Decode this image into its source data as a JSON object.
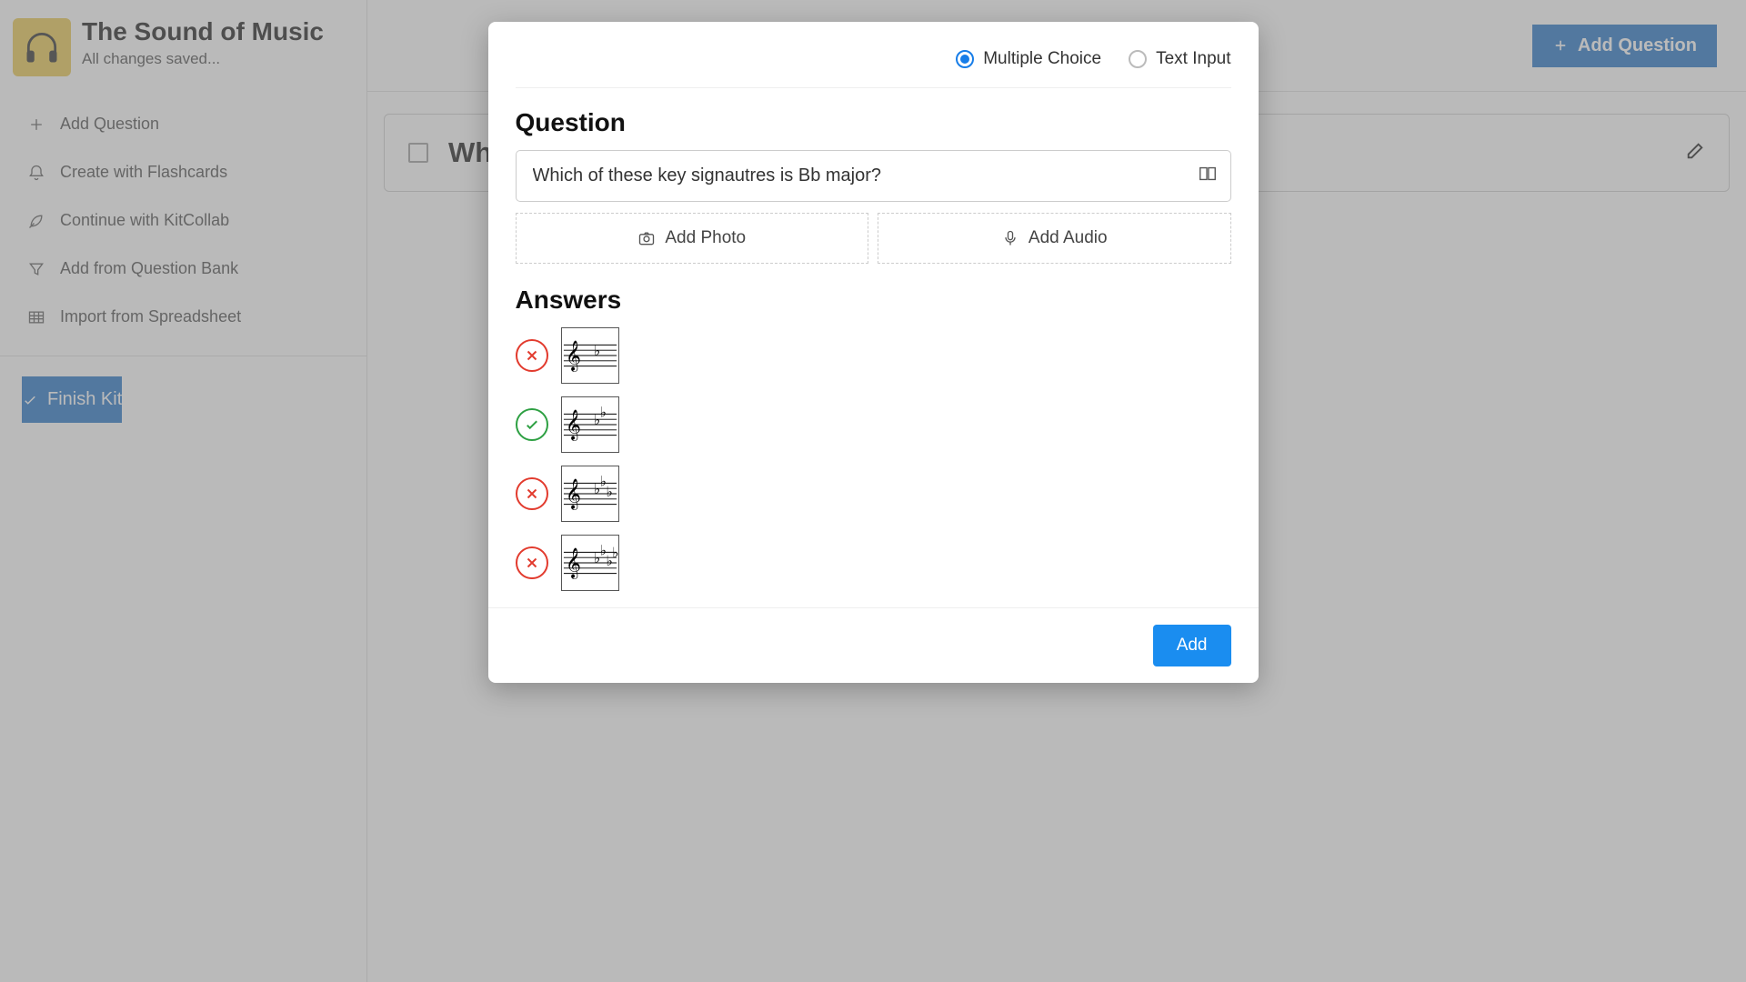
{
  "kit": {
    "title": "The Sound of Music",
    "status": "All changes saved..."
  },
  "sidebar": {
    "items": [
      {
        "label": "Add Question"
      },
      {
        "label": "Create with Flashcards"
      },
      {
        "label": "Continue with KitCollab"
      },
      {
        "label": "Add from Question Bank"
      },
      {
        "label": "Import from Spreadsheet"
      }
    ],
    "finish_label": "Finish Kit"
  },
  "topbar": {
    "add_question_label": "Add Question"
  },
  "existing_question": {
    "preview": "Wh"
  },
  "modal": {
    "type_options": {
      "multiple_choice": "Multiple Choice",
      "text_input": "Text Input",
      "selected": "multiple_choice"
    },
    "question_heading": "Question",
    "question_text": "Which of these key signautres is Bb major?",
    "add_photo_label": "Add Photo",
    "add_audio_label": "Add Audio",
    "answers_heading": "Answers",
    "answers": [
      {
        "correct": false,
        "flats": 1
      },
      {
        "correct": true,
        "flats": 2
      },
      {
        "correct": false,
        "flats": 3
      },
      {
        "correct": false,
        "flats": 4
      }
    ],
    "add_button": "Add"
  }
}
